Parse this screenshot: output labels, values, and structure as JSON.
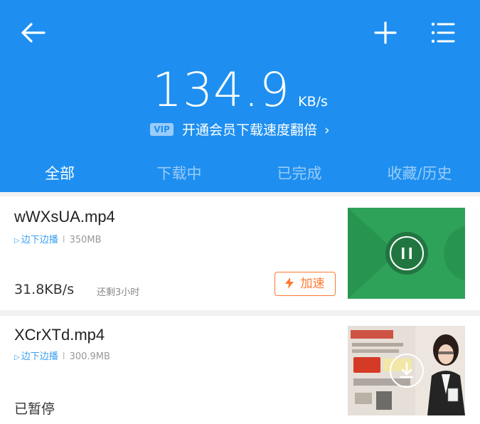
{
  "header": {
    "speed_value": "134.9",
    "speed_unit": "KB/s",
    "vip_badge": "VIP",
    "vip_text": "开通会员下载速度翻倍",
    "vip_arrow": "›"
  },
  "tabs": [
    {
      "label": "全部",
      "active": true
    },
    {
      "label": "下载中",
      "active": false
    },
    {
      "label": "已完成",
      "active": false
    },
    {
      "label": "收藏/历史",
      "active": false
    }
  ],
  "downloads": [
    {
      "name": "wWXsUA.mp4",
      "play_label": "边下边播",
      "separator": "I",
      "size": "350MB",
      "speed": "31.8KB/s",
      "remaining": "还剩3小时",
      "boost_label": "加速",
      "state": "downloading"
    },
    {
      "name": "XCrXTd.mp4",
      "play_label": "边下边播",
      "separator": "I",
      "size": "300.9MB",
      "status": "已暂停",
      "state": "paused"
    }
  ],
  "icons": {
    "back": "back-arrow-icon",
    "add": "plus-icon",
    "menu": "list-menu-icon",
    "pause": "pause-icon",
    "download": "download-icon",
    "boost": "lightning-icon",
    "play": "play-triangle-icon"
  },
  "colors": {
    "header_bg": "#1e8ff0",
    "accent_orange": "#ff7a30",
    "link_blue": "#3aa0f0",
    "thumb_green": "#2fa25a"
  }
}
